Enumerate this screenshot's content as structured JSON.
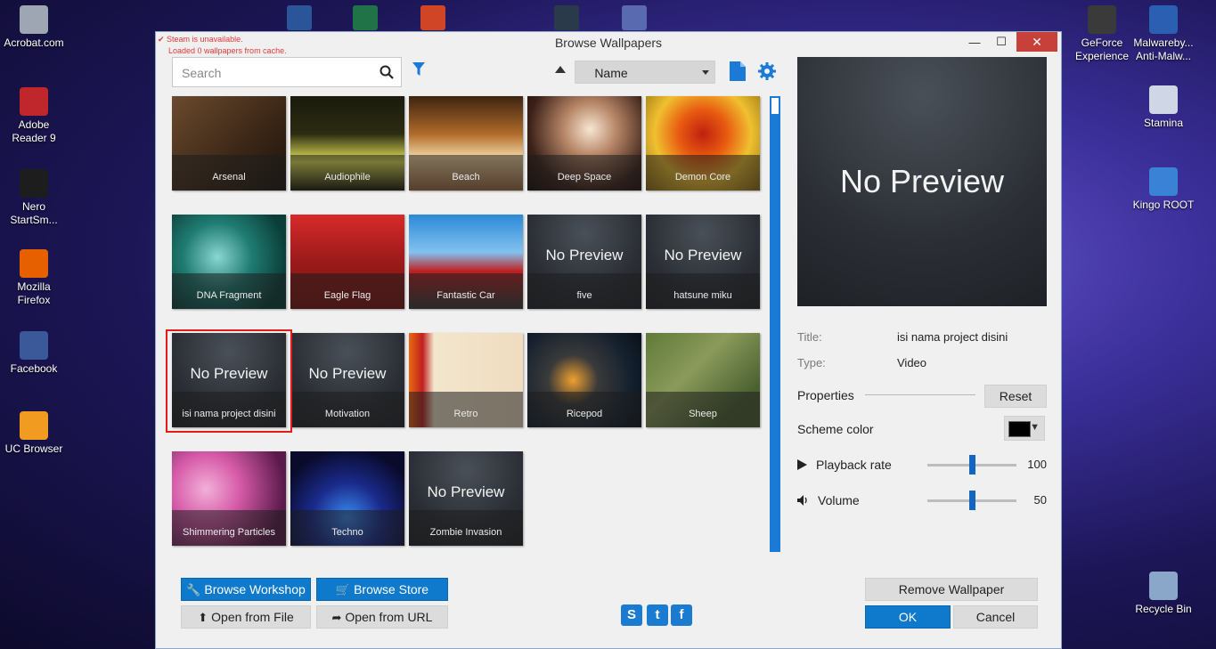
{
  "desktop": {
    "left_icons": [
      {
        "label": "Acrobat.com",
        "icon": "acrobat-icon",
        "color": "#9ea6b4"
      },
      {
        "label": "Adobe Reader 9",
        "icon": "adobe-reader-icon",
        "color": "#c0272d"
      },
      {
        "label": "Nero StartSm...",
        "icon": "nero-icon",
        "color": "#1d1d1d"
      },
      {
        "label": "Mozilla Firefox",
        "icon": "firefox-icon",
        "color": "#e66000"
      },
      {
        "label": "Facebook",
        "icon": "facebook-icon",
        "color": "#3b5998"
      },
      {
        "label": "UC Browser",
        "icon": "uc-browser-icon",
        "color": "#f29b21"
      }
    ],
    "right_icons": [
      {
        "label": "GeForce Experience",
        "icon": "geforce-icon",
        "color": "#3a3a3a"
      },
      {
        "label": "Malwareby... Anti-Malw...",
        "icon": "malwarebytes-icon",
        "color": "#2b5fb2"
      },
      {
        "label": "Stamina",
        "icon": "stamina-icon",
        "color": "#cfd7e6"
      },
      {
        "label": "Kingo ROOT",
        "icon": "kingo-root-icon",
        "color": "#3a82d6"
      },
      {
        "label": "Recycle Bin",
        "icon": "recycle-bin-icon",
        "color": "#8aa6c8"
      }
    ]
  },
  "window": {
    "title": "Browse Wallpapers",
    "steam_error": "Steam is unavailable.",
    "cache_note": "Loaded 0 wallpapers from cache.",
    "minimize": "—",
    "maximize": "☐",
    "close": "✕"
  },
  "toolbar": {
    "search_placeholder": "Search",
    "sort_value": "Name"
  },
  "no_preview_text": "No Preview",
  "wallpapers": [
    {
      "title": "Arsenal",
      "preview": "image",
      "bg": "linear-gradient(135deg,#6b4a2e,#3a2616 60%,#1d140c)"
    },
    {
      "title": "Audiophile",
      "preview": "image",
      "bg": "linear-gradient(180deg,#1a1a0e,#2c2c12 40%,#e6e65a 70%,#1a1a0a)"
    },
    {
      "title": "Beach",
      "preview": "image",
      "bg": "linear-gradient(180deg,#3c2410,#b06a2a 40%,#f2d6a0 65%,#9a6a40)"
    },
    {
      "title": "Deep Space",
      "preview": "image",
      "bg": "radial-gradient(circle at 55% 35%,#f6e7d2,#b88768 30%,#3a2018 70%,#120a08)"
    },
    {
      "title": "Demon Core",
      "preview": "image",
      "bg": "radial-gradient(circle at 50% 40%,#c02010,#e85a10 30%,#f0c030 60%,#8a6a10)"
    },
    {
      "title": "DNA Fragment",
      "preview": "image",
      "bg": "radial-gradient(circle at 40% 45%,#8ad6d2,#1f7c72 40%,#0b3e38 80%)"
    },
    {
      "title": "Eagle Flag",
      "preview": "image",
      "bg": "linear-gradient(180deg,#d62a2a,#9b1a1a 50%,#7a1010)"
    },
    {
      "title": "Fantastic Car",
      "preview": "image",
      "bg": "linear-gradient(180deg,#2a8ad6,#82c2f0 40%,#c02020 60%,#3a3a3a)"
    },
    {
      "title": "five",
      "preview": "none",
      "bg": "radial-gradient(circle at 50% 20%,#4a5058,#2b2f35 60%,#1e2126)"
    },
    {
      "title": "hatsune miku",
      "preview": "none",
      "bg": "radial-gradient(circle at 50% 20%,#4a5058,#2b2f35 60%,#1e2126)"
    },
    {
      "title": "isi nama project disini",
      "preview": "none",
      "bg": "radial-gradient(circle at 50% 20%,#4a5058,#2b2f35 60%,#1e2126)"
    },
    {
      "title": "Motivation",
      "preview": "none",
      "bg": "radial-gradient(circle at 50% 20%,#4a5058,#2b2f35 60%,#1e2126)"
    },
    {
      "title": "Retro",
      "preview": "image",
      "bg": "linear-gradient(90deg,#e86a10 0%,#c02020 12%,#f2e6cc 22%,#f0dcc0 100%)"
    },
    {
      "title": "Ricepod",
      "preview": "image",
      "bg": "radial-gradient(circle at 40% 50%,#f0a030,#3a3a3a 30%,#14202e 70%,#0a1018)"
    },
    {
      "title": "Sheep",
      "preview": "image",
      "bg": "linear-gradient(135deg,#5f7a3a,#8a9a5a 40%,#4a6030 80%)"
    },
    {
      "title": "Shimmering Particles",
      "preview": "image",
      "bg": "radial-gradient(circle at 30% 40%,#f2b0d8,#d65aa8 35%,#5a1a4a 80%)"
    },
    {
      "title": "Techno",
      "preview": "image",
      "bg": "radial-gradient(circle at 50% 70%,#3a8af0,#1a2a8a 40%,#0a0a2a 80%)"
    },
    {
      "title": "Zombie Invasion",
      "preview": "none",
      "bg": "radial-gradient(circle at 50% 20%,#4a5058,#2b2f35 60%,#1e2126)"
    }
  ],
  "selected_index": 10,
  "details": {
    "title_label": "Title:",
    "title_value": "isi nama project disini",
    "type_label": "Type:",
    "type_value": "Video",
    "properties_heading": "Properties",
    "reset_label": "Reset",
    "scheme_color_label": "Scheme color",
    "scheme_color": "#000000",
    "playback_label": "Playback rate",
    "playback_value": "100",
    "playback_level": 0.5,
    "volume_label": "Volume",
    "volume_value": "50",
    "volume_level": 0.5
  },
  "buttons": {
    "browse_workshop": "Browse Workshop",
    "browse_store": "Browse Store",
    "open_file": "Open from File",
    "open_url": "Open from URL",
    "remove_wallpaper": "Remove Wallpaper",
    "ok": "OK",
    "cancel": "Cancel"
  },
  "social": [
    {
      "name": "steam-icon",
      "glyph": "S"
    },
    {
      "name": "twitter-icon",
      "glyph": "t"
    },
    {
      "name": "facebook-share-icon",
      "glyph": "f"
    }
  ],
  "colors": {
    "accent": "#0f7acb",
    "selection_outline": "#e21b1b",
    "error_text": "#e03a3a"
  }
}
